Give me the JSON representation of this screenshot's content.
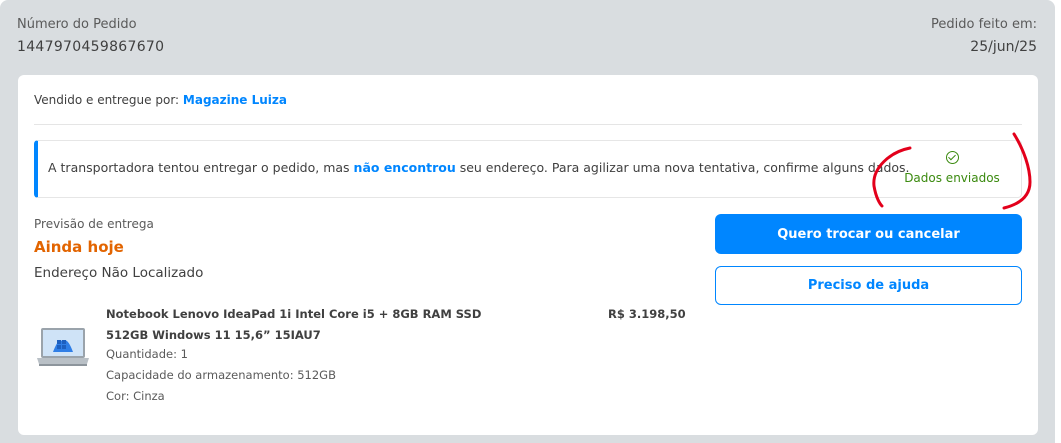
{
  "order": {
    "number_label": "Número do Pedido",
    "number": "1447970459867670",
    "date_label": "Pedido feito em:",
    "date": "25/jun/25"
  },
  "seller": {
    "prefix": "Vendido e entregue por:",
    "name": "Magazine Luiza"
  },
  "notice": {
    "text_before": "A transportadora tentou entregar o pedido, mas ",
    "text_highlight": "não encontrou",
    "text_after": " seu endereço. Para agilizar uma nova tentativa, confirme alguns dados.",
    "status_icon": "check-circle-icon",
    "status_label": "Dados enviados"
  },
  "delivery": {
    "label": "Previsão de entrega",
    "value": "Ainda hoje",
    "address_status": "Endereço Não Localizado"
  },
  "product": {
    "title": "Notebook Lenovo IdeaPad 1i Intel Core i5 + 8GB RAM SSD 512GB Windows 11 15,6” 15IAU7",
    "price": "R$ 3.198,50",
    "quantity": "Quantidade: 1",
    "storage": "Capacidade do armazenamento: 512GB",
    "color": "Cor: Cinza"
  },
  "actions": {
    "primary_label": "Quero trocar ou cancelar",
    "secondary_label": "Preciso de ajuda"
  },
  "colors": {
    "accent": "#0086ff",
    "delivery": "#e26400",
    "success": "#3b8a0f",
    "annotation": "#e3001b"
  }
}
